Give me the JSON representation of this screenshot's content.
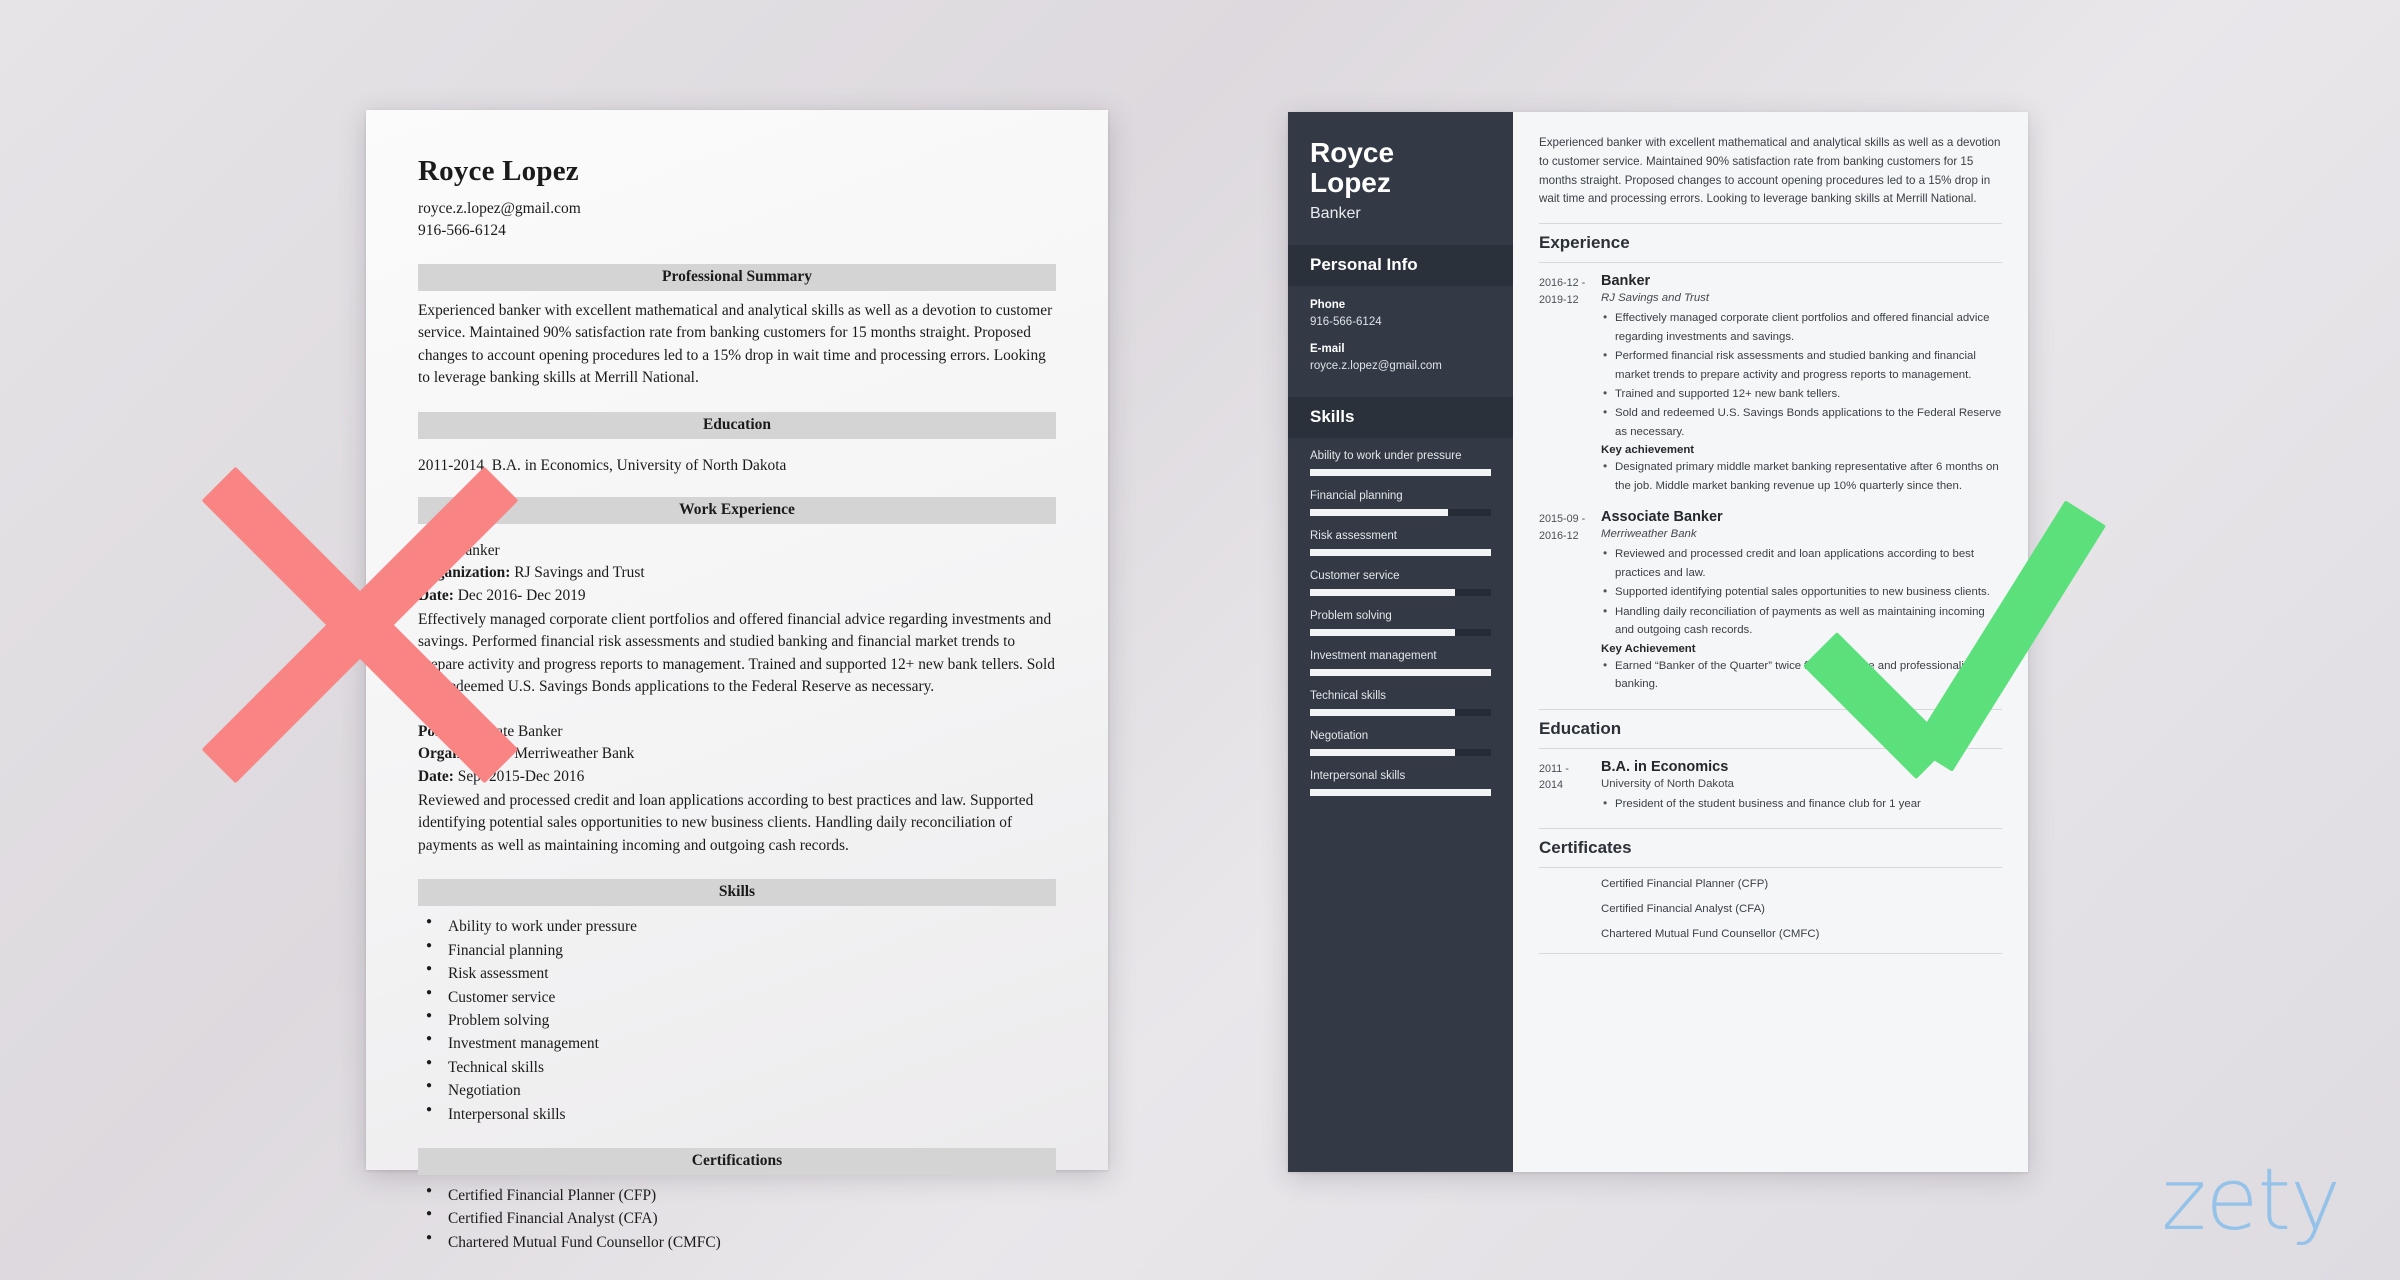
{
  "bad_resume": {
    "name": "Royce Lopez",
    "email": "royce.z.lopez@gmail.com",
    "phone": "916-566-6124",
    "sections": {
      "summary_heading": "Professional Summary",
      "summary_text": "Experienced banker with excellent mathematical and analytical skills as well as a devotion to customer service. Maintained 90% satisfaction rate from banking customers for 15 months straight. Proposed changes to account opening procedures led to a 15% drop in wait time and processing errors. Looking to leverage banking skills at Merrill National.",
      "education_heading": "Education",
      "education_line": "2011-2014, B.A. in Economics, University of North Dakota",
      "experience_heading": "Work Experience",
      "skills_heading": "Skills",
      "certifications_heading": "Certifications"
    },
    "jobs": [
      {
        "post_label": "Post:",
        "post_value": "Banker",
        "org_label": "Organization:",
        "org_value": "RJ Savings and Trust",
        "date_label": "Date:",
        "date_value": "Dec 2016- Dec 2019",
        "description": "Effectively managed corporate client portfolios and offered financial advice regarding investments and savings. Performed financial risk assessments and studied banking and financial market trends to prepare activity and progress reports to management. Trained and supported 12+ new bank tellers. Sold and redeemed U.S. Savings Bonds applications to the Federal Reserve as necessary."
      },
      {
        "post_label": "Post:",
        "post_value": "Associate Banker",
        "org_label": "Organization:",
        "org_value": "Merriweather Bank",
        "date_label": "Date:",
        "date_value": "Sept 2015-Dec 2016",
        "description": "Reviewed and processed credit and loan applications according to best practices and law. Supported identifying potential sales opportunities to new business clients. Handling daily reconciliation of payments as well as maintaining incoming and outgoing cash records."
      }
    ],
    "skills": [
      "Ability to work under pressure",
      "Financial planning",
      "Risk assessment",
      "Customer service",
      "Problem solving",
      "Investment management",
      "Technical skills",
      "Negotiation",
      "Interpersonal skills"
    ],
    "certifications": [
      "Certified Financial Planner (CFP)",
      "Certified Financial Analyst (CFA)",
      "Chartered Mutual Fund Counsellor (CMFC)"
    ]
  },
  "good_resume": {
    "sidebar": {
      "name_line1": "Royce",
      "name_line2": "Lopez",
      "job_title": "Banker",
      "personal_info_heading": "Personal Info",
      "phone_label": "Phone",
      "phone_value": "916-566-6124",
      "email_label": "E-mail",
      "email_value": "royce.z.lopez@gmail.com",
      "skills_heading": "Skills",
      "skills": [
        {
          "name": "Ability to work under pressure",
          "level": 100
        },
        {
          "name": "Financial planning",
          "level": 76
        },
        {
          "name": "Risk assessment",
          "level": 100
        },
        {
          "name": "Customer service",
          "level": 80
        },
        {
          "name": "Problem solving",
          "level": 80
        },
        {
          "name": "Investment management",
          "level": 100
        },
        {
          "name": "Technical skills",
          "level": 80
        },
        {
          "name": "Negotiation",
          "level": 80
        },
        {
          "name": "Interpersonal skills",
          "level": 100
        }
      ]
    },
    "main": {
      "summary": "Experienced banker with excellent mathematical and analytical skills as well as a devotion to customer service. Maintained 90% satisfaction rate from banking customers for 15 months straight. Proposed changes to account opening procedures led to a 15% drop in wait time and processing errors. Looking to leverage banking skills at Merrill National.",
      "experience_heading": "Experience",
      "experience": [
        {
          "date_from": "2016-12 -",
          "date_to": "2019-12",
          "role": "Banker",
          "org": "RJ Savings and Trust",
          "bullets": [
            "Effectively managed corporate client portfolios and offered financial advice regarding investments and savings.",
            "Performed financial risk assessments and studied banking and financial market trends to prepare activity and progress reports to management.",
            "Trained and supported 12+ new bank tellers.",
            "Sold and redeemed U.S. Savings Bonds applications to the Federal Reserve as necessary."
          ],
          "key_achievement_label": "Key achievement",
          "key_achievement_bullets": [
            "Designated primary middle market banking representative after 6 months on the job. Middle market banking revenue up 10% quarterly since then."
          ]
        },
        {
          "date_from": "2015-09 -",
          "date_to": "2016-12",
          "role": "Associate Banker",
          "org": "Merriweather Bank",
          "bullets": [
            "Reviewed and processed credit and loan applications according to best practices and law.",
            "Supported identifying potential sales opportunities to new business clients.",
            "Handling daily reconciliation of payments as well as maintaining incoming and outgoing cash records."
          ],
          "key_achievement_label": "Key Achievement",
          "key_achievement_bullets": [
            "Earned “Banker of the Quarter” twice for excellence and professionalism in banking."
          ]
        }
      ],
      "education_heading": "Education",
      "education": [
        {
          "date_from": "2011 -",
          "date_to": "2014",
          "degree": "B.A. in Economics",
          "school": "University of North Dakota",
          "bullets": [
            "President of the student business and finance club for 1 year"
          ]
        }
      ],
      "certificates_heading": "Certificates",
      "certificates": [
        "Certified Financial Planner (CFP)",
        "Certified Financial Analyst (CFA)",
        "Chartered Mutual Fund Counsellor (CMFC)"
      ]
    }
  },
  "overlay": {
    "reject_mark": "x-mark",
    "approve_mark": "check-mark",
    "reject_color": "#f98484",
    "approve_color": "#5ce07b"
  },
  "branding": {
    "logo_text": "zety",
    "logo_color": "#8fc0ea"
  }
}
